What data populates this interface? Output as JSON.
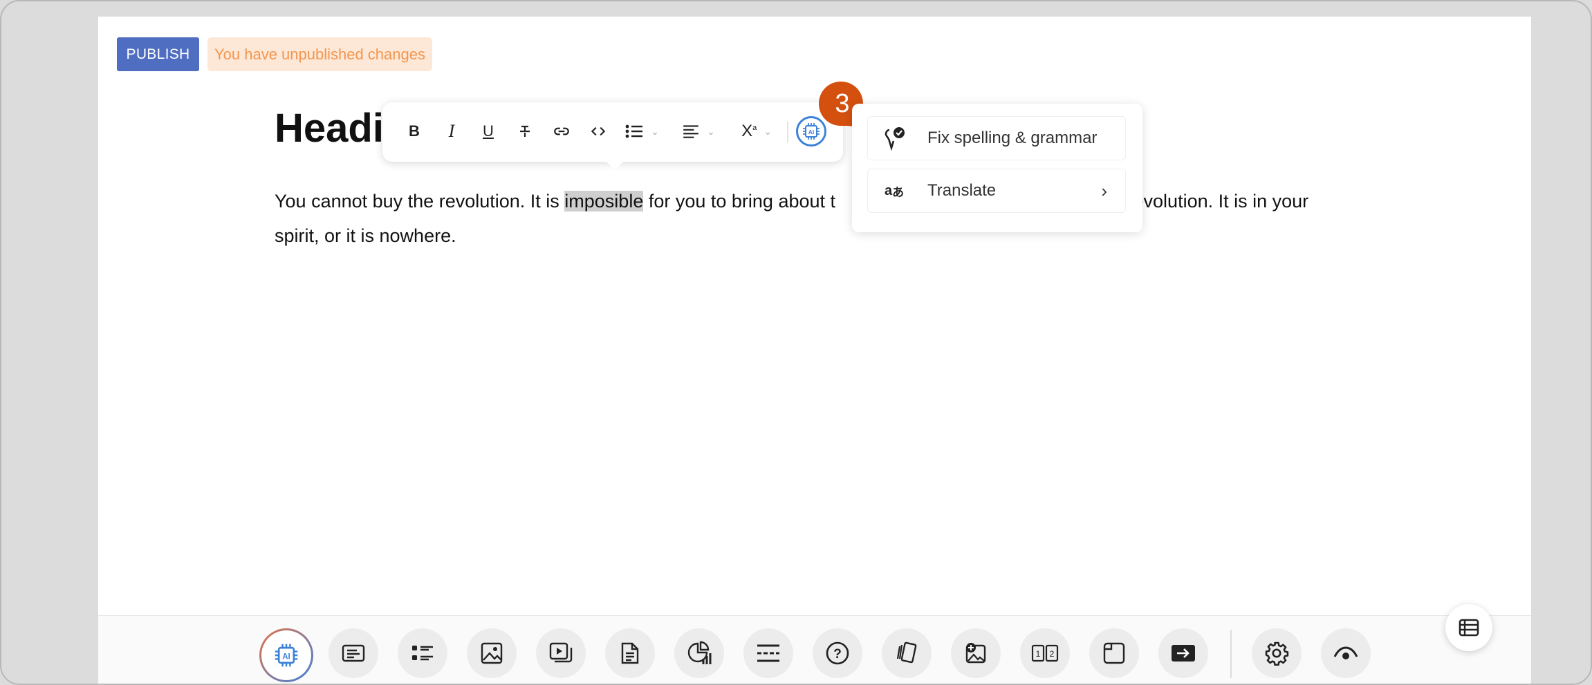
{
  "header": {
    "publish_label": "PUBLISH",
    "unpublished_notice": "You have unpublished changes"
  },
  "document": {
    "heading_visible": "Headi",
    "paragraph": {
      "before": "You cannot buy the revolution. It is ",
      "selected_word": "imposible",
      "middle": " for you to bring about t",
      "after": " revolution. It is in your spirit, or it is nowhere."
    }
  },
  "format_toolbar": {
    "items": [
      "bold-icon",
      "italic-icon",
      "underline-icon",
      "strikethrough-icon",
      "link-icon",
      "code-icon",
      "bullet-list-icon",
      "align-icon",
      "superscript-icon",
      "ai-chip-icon"
    ],
    "superscript_label": "X"
  },
  "step_badge": {
    "number": "3",
    "color": "#d4500f"
  },
  "ai_menu": {
    "items": [
      {
        "label": "Fix spelling & grammar",
        "icon": "spell-check-icon"
      },
      {
        "label": "Translate",
        "icon": "translate-icon",
        "has_submenu": true
      }
    ],
    "arrow": "›"
  },
  "bottom_toolbar": {
    "tools": [
      "ai-chip-icon",
      "text-block-icon",
      "list-icon",
      "image-icon",
      "video-icon",
      "document-icon",
      "chart-icon",
      "divider-icon",
      "quiz-icon",
      "flashcard-icon",
      "image-hotspot-icon",
      "numbered-steps-icon",
      "embed-icon",
      "redirect-icon",
      "settings-icon",
      "preview-icon"
    ]
  },
  "colors": {
    "publish_bg": "#4f6ec2",
    "notice_bg": "#fde7d6",
    "notice_text": "#f3964f",
    "ai_blue": "#3d82d8",
    "badge_orange": "#d4500f"
  }
}
